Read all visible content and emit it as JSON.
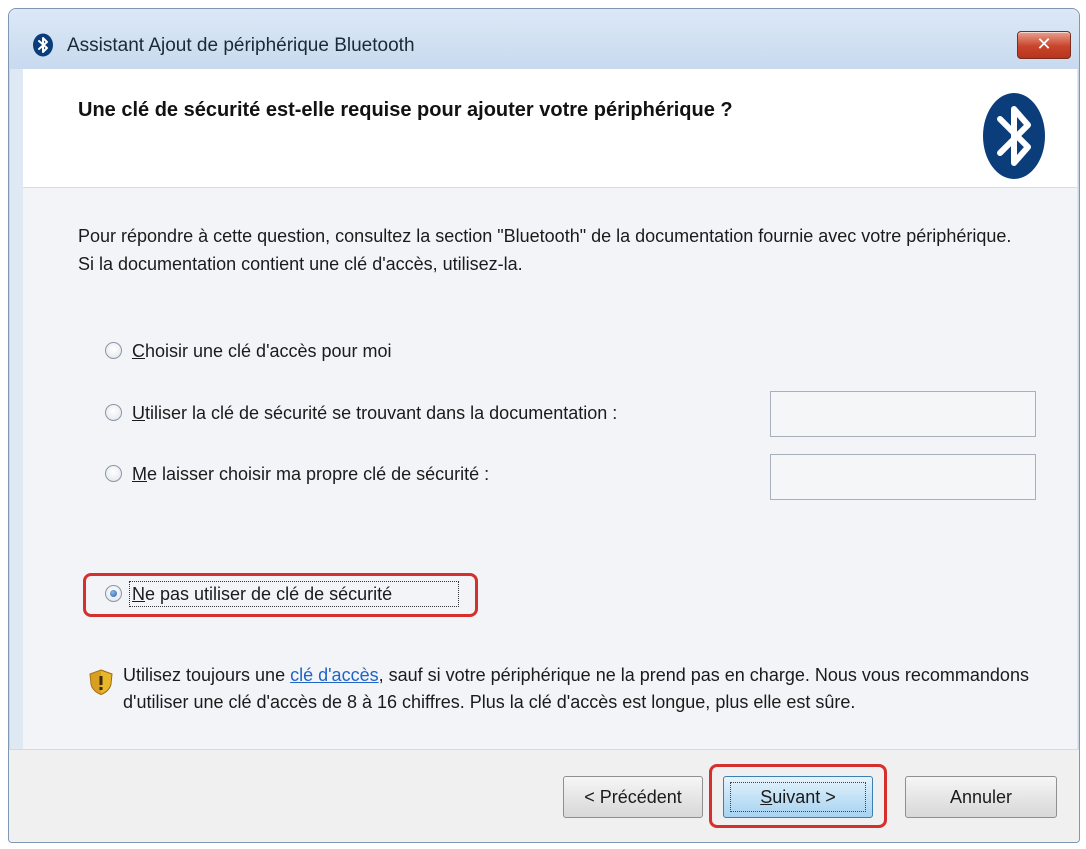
{
  "window": {
    "title": "Assistant Ajout de périphérique Bluetooth",
    "close_label": "✕"
  },
  "header": {
    "question": "Une clé de sécurité est-elle requise pour ajouter votre périphérique ?"
  },
  "intro_text": "Pour répondre à cette question, consultez la section \"Bluetooth\" de la documentation fournie avec votre périphérique. Si la documentation contient une clé d'accès, utilisez-la.",
  "options": [
    {
      "accel": "C",
      "rest": "hoisir une clé d'accès pour moi",
      "checked": false
    },
    {
      "accel": "U",
      "rest": "tiliser la clé de sécurité se trouvant dans la documentation :",
      "checked": false
    },
    {
      "accel": "M",
      "rest": "e laisser choisir ma propre clé de sécurité :",
      "checked": false
    },
    {
      "accel": "N",
      "rest": "e pas utiliser de clé de sécurité",
      "checked": true
    }
  ],
  "inputs": {
    "documentation_key_value": "",
    "custom_key_value": ""
  },
  "warning": {
    "before_link": "Utilisez toujours une ",
    "link": "clé d'accès",
    "after_link": ", sauf si votre périphérique ne la prend pas en charge. Nous vous recommandons d'utiliser une clé d'accès de 8 à 16 chiffres. Plus la clé d'accès est longue, plus elle est sûre."
  },
  "buttons": {
    "previous": "< Précédent",
    "next_accel": "S",
    "next_rest": "uivant >",
    "cancel": "Annuler"
  },
  "colors": {
    "highlight": "#d6302e",
    "link": "#1f64c6",
    "bluetooth": "#0a3d7a"
  },
  "icons": {
    "title": "bluetooth-icon",
    "logo": "bluetooth-logo",
    "warning": "shield-warning-icon"
  }
}
